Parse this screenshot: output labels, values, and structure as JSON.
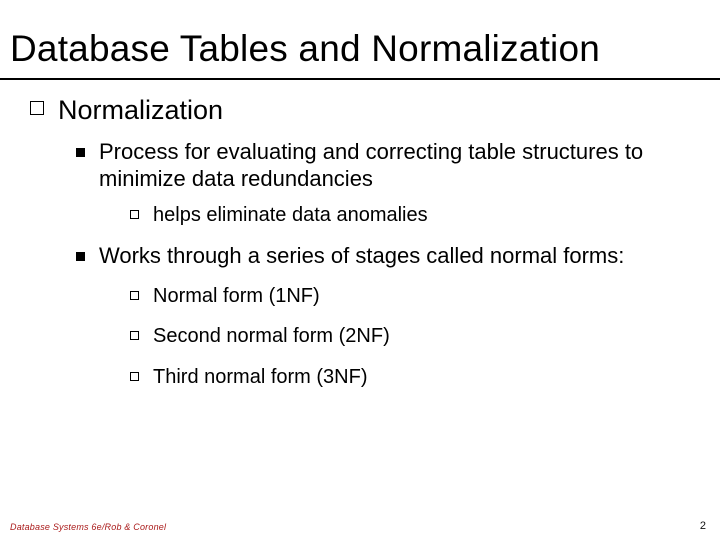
{
  "title": "Database Tables and Normalization",
  "lvl1": {
    "text": "Normalization"
  },
  "lvl2a": {
    "text": "Process for evaluating and correcting table structures to minimize data redundancies"
  },
  "lvl3a": {
    "text": "helps eliminate data anomalies"
  },
  "lvl2b": {
    "text": "Works through a series of stages called normal forms:"
  },
  "lvl3b": {
    "text": "Normal form (1NF)"
  },
  "lvl3c": {
    "text": "Second normal form (2NF)"
  },
  "lvl3d": {
    "text": "Third normal form (3NF)"
  },
  "footer_left": "Database Systems 6e/Rob & Coronel",
  "footer_right": "2"
}
